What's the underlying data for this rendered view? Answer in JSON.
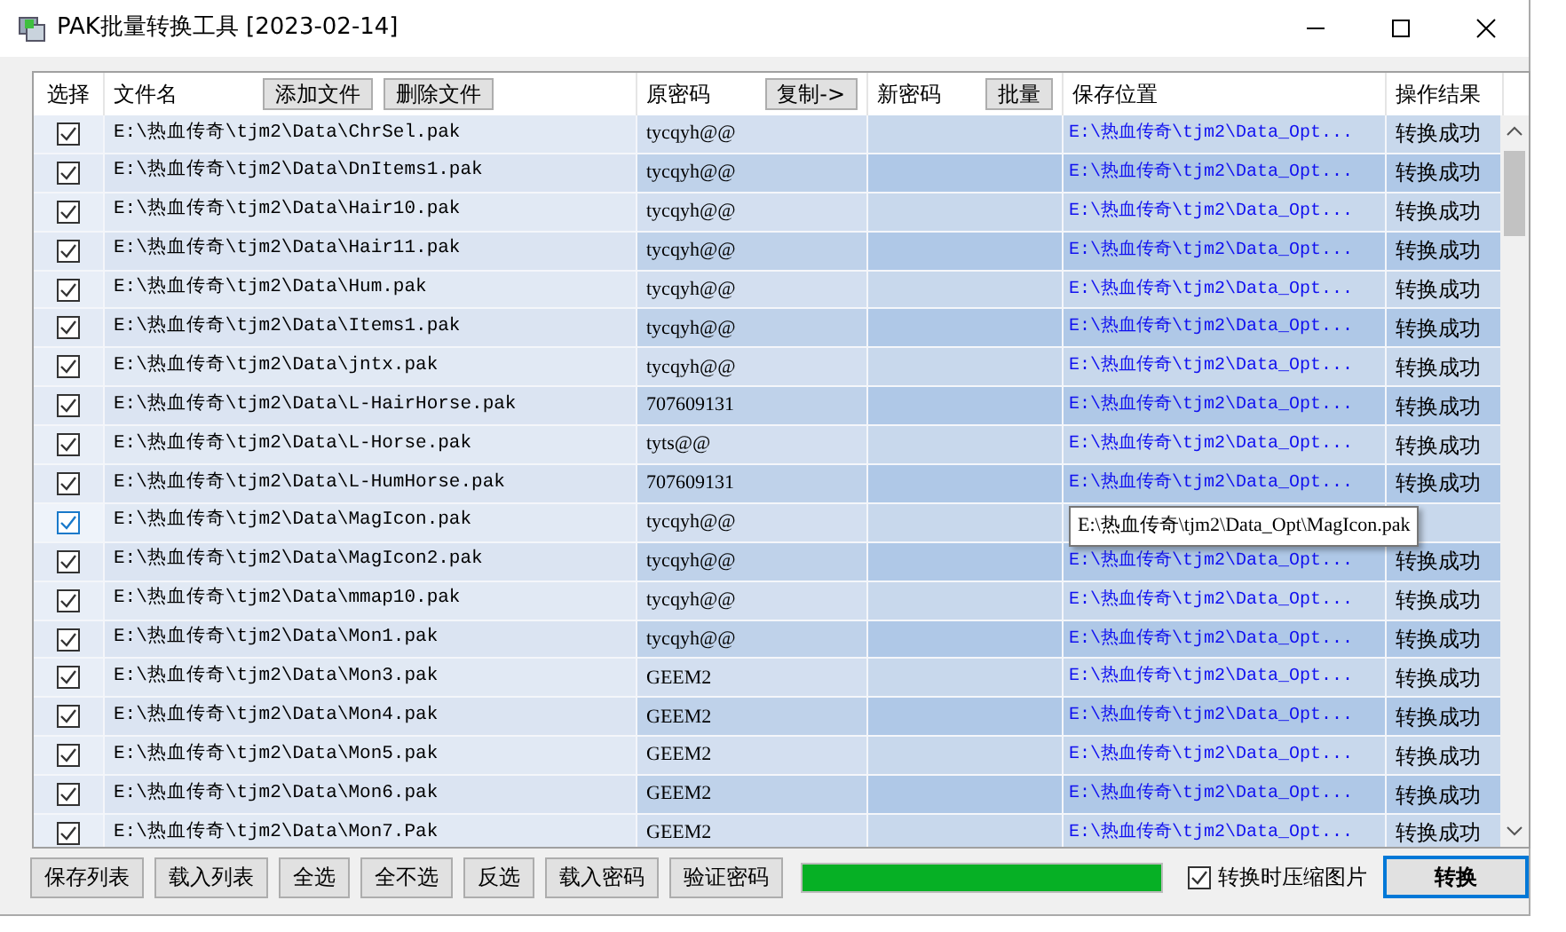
{
  "window": {
    "title": "PAK批量转换工具 [2023-02-14]"
  },
  "table": {
    "columns": [
      {
        "label": "选择"
      },
      {
        "label": "文件名",
        "buttons": [
          "添加文件",
          "删除文件"
        ]
      },
      {
        "label": "原密码",
        "buttons": [
          "复制->"
        ]
      },
      {
        "label": "新密码",
        "buttons": [
          "批量"
        ]
      },
      {
        "label": "保存位置"
      },
      {
        "label": "操作结果"
      }
    ],
    "rows": [
      {
        "checked": true,
        "hovered": false,
        "file": "E:\\热血传奇\\tjm2\\Data\\ChrSel.pak",
        "old_password": "tycqyh@@",
        "save_location": "E:\\热血传奇\\tjm2\\Data_Opt...",
        "result": "转换成功"
      },
      {
        "checked": true,
        "hovered": false,
        "file": "E:\\热血传奇\\tjm2\\Data\\DnItems1.pak",
        "old_password": "tycqyh@@",
        "save_location": "E:\\热血传奇\\tjm2\\Data_Opt...",
        "result": "转换成功"
      },
      {
        "checked": true,
        "hovered": false,
        "file": "E:\\热血传奇\\tjm2\\Data\\Hair10.pak",
        "old_password": "tycqyh@@",
        "save_location": "E:\\热血传奇\\tjm2\\Data_Opt...",
        "result": "转换成功"
      },
      {
        "checked": true,
        "hovered": false,
        "file": "E:\\热血传奇\\tjm2\\Data\\Hair11.pak",
        "old_password": "tycqyh@@",
        "save_location": "E:\\热血传奇\\tjm2\\Data_Opt...",
        "result": "转换成功"
      },
      {
        "checked": true,
        "hovered": false,
        "file": "E:\\热血传奇\\tjm2\\Data\\Hum.pak",
        "old_password": "tycqyh@@",
        "save_location": "E:\\热血传奇\\tjm2\\Data_Opt...",
        "result": "转换成功"
      },
      {
        "checked": true,
        "hovered": false,
        "file": "E:\\热血传奇\\tjm2\\Data\\Items1.pak",
        "old_password": "tycqyh@@",
        "save_location": "E:\\热血传奇\\tjm2\\Data_Opt...",
        "result": "转换成功"
      },
      {
        "checked": true,
        "hovered": false,
        "file": "E:\\热血传奇\\tjm2\\Data\\jntx.pak",
        "old_password": "tycqyh@@",
        "save_location": "E:\\热血传奇\\tjm2\\Data_Opt...",
        "result": "转换成功"
      },
      {
        "checked": true,
        "hovered": false,
        "file": "E:\\热血传奇\\tjm2\\Data\\L-HairHorse.pak",
        "old_password": "707609131",
        "save_location": "E:\\热血传奇\\tjm2\\Data_Opt...",
        "result": "转换成功"
      },
      {
        "checked": true,
        "hovered": false,
        "file": "E:\\热血传奇\\tjm2\\Data\\L-Horse.pak",
        "old_password": "tyts@@",
        "save_location": "E:\\热血传奇\\tjm2\\Data_Opt...",
        "result": "转换成功"
      },
      {
        "checked": true,
        "hovered": false,
        "file": "E:\\热血传奇\\tjm2\\Data\\L-HumHorse.pak",
        "old_password": "707609131",
        "save_location": "E:\\热血传奇\\tjm2\\Data_Opt...",
        "result": "转换成功"
      },
      {
        "checked": true,
        "hovered": true,
        "file": "E:\\热血传奇\\tjm2\\Data\\MagIcon.pak",
        "old_password": "tycqyh@@"
      },
      {
        "checked": true,
        "hovered": false,
        "file": "E:\\热血传奇\\tjm2\\Data\\MagIcon2.pak",
        "old_password": "tycqyh@@",
        "save_location": "E:\\热血传奇\\tjm2\\Data_Opt...",
        "result": "转换成功"
      },
      {
        "checked": true,
        "hovered": false,
        "file": "E:\\热血传奇\\tjm2\\Data\\mmap10.pak",
        "old_password": "tycqyh@@",
        "save_location": "E:\\热血传奇\\tjm2\\Data_Opt...",
        "result": "转换成功"
      },
      {
        "checked": true,
        "hovered": false,
        "file": "E:\\热血传奇\\tjm2\\Data\\Mon1.pak",
        "old_password": "tycqyh@@",
        "save_location": "E:\\热血传奇\\tjm2\\Data_Opt...",
        "result": "转换成功"
      },
      {
        "checked": true,
        "hovered": false,
        "file": "E:\\热血传奇\\tjm2\\Data\\Mon3.pak",
        "old_password": "GEEM2",
        "save_location": "E:\\热血传奇\\tjm2\\Data_Opt...",
        "result": "转换成功"
      },
      {
        "checked": true,
        "hovered": false,
        "file": "E:\\热血传奇\\tjm2\\Data\\Mon4.pak",
        "old_password": "GEEM2",
        "save_location": "E:\\热血传奇\\tjm2\\Data_Opt...",
        "result": "转换成功"
      },
      {
        "checked": true,
        "hovered": false,
        "file": "E:\\热血传奇\\tjm2\\Data\\Mon5.pak",
        "old_password": "GEEM2",
        "save_location": "E:\\热血传奇\\tjm2\\Data_Opt...",
        "result": "转换成功"
      },
      {
        "checked": true,
        "hovered": false,
        "file": "E:\\热血传奇\\tjm2\\Data\\Mon6.pak",
        "old_password": "GEEM2",
        "save_location": "E:\\热血传奇\\tjm2\\Data_Opt...",
        "result": "转换成功"
      },
      {
        "checked": true,
        "hovered": false,
        "file": "E:\\热血传奇\\tjm2\\Data\\Mon7.Pak",
        "old_password": "GEEM2",
        "save_location": "E:\\热血传奇\\tjm2\\Data_Opt...",
        "result": "转换成功"
      }
    ]
  },
  "tooltip": {
    "text": "E:\\热血传奇\\tjm2\\Data_Opt\\MagIcon.pak"
  },
  "footer": {
    "buttons": [
      "保存列表",
      "载入列表",
      "全选",
      "全不选",
      "反选",
      "载入密码",
      "验证密码"
    ],
    "progress": {
      "level": 1
    },
    "compress_images": {
      "label": "转换时压缩图片",
      "checked": true
    },
    "convert_button": "转换"
  }
}
